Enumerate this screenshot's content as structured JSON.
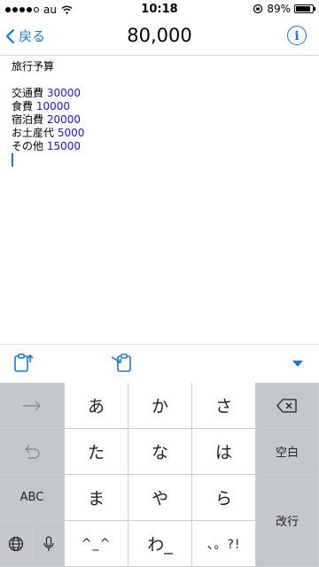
{
  "status_bar": {
    "carrier": "au",
    "time": "10:18",
    "battery": "89%",
    "battery_level": 0.89
  },
  "nav": {
    "back_label": "戻る",
    "title": "80,000",
    "info_icon": "info-icon"
  },
  "memo": {
    "title": "旅行予算",
    "items": [
      {
        "label": "交通費",
        "value": "30000"
      },
      {
        "label": "食費",
        "value": "10000"
      },
      {
        "label": "宿泊費",
        "value": "20000"
      },
      {
        "label": "お土産代",
        "value": "5000"
      },
      {
        "label": "その他",
        "value": "15000"
      }
    ]
  },
  "keyboard": {
    "row1": [
      "あ",
      "か",
      "さ"
    ],
    "row2": [
      "た",
      "な",
      "は"
    ],
    "row3": [
      "ま",
      "や",
      "ら"
    ],
    "row4": [
      "^_^",
      "わ_",
      "、。?!"
    ],
    "abc_label": "ABC",
    "space_label": "空白",
    "return_label": "改行"
  },
  "colors": {
    "accent": "#1a73e8",
    "number": "#1515d6",
    "key_gray": "#c4c8ce"
  }
}
